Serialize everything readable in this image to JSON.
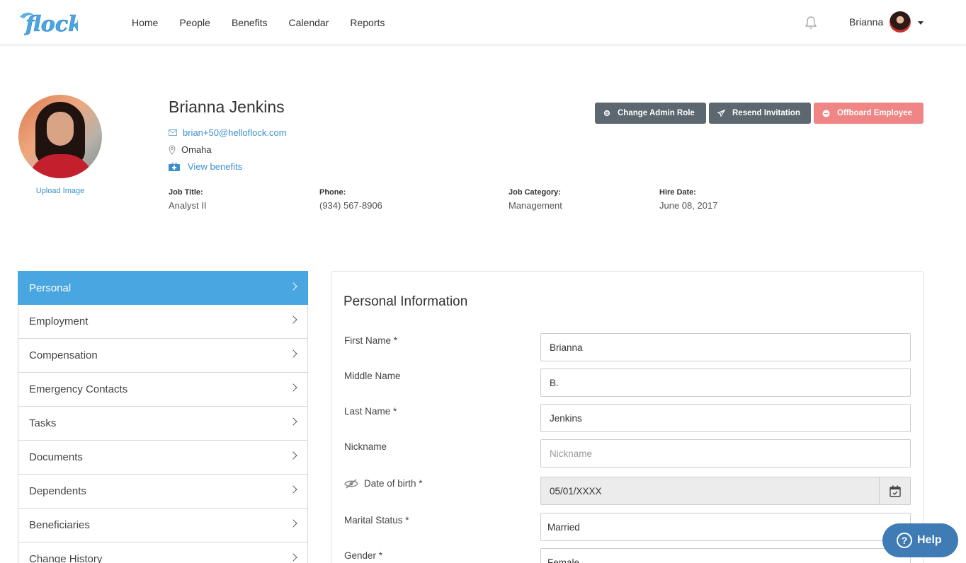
{
  "app": {
    "logo_text": "flock"
  },
  "nav": [
    "Home",
    "People",
    "Benefits",
    "Calendar",
    "Reports"
  ],
  "user": {
    "name": "Brianna"
  },
  "profile": {
    "name": "Brianna Jenkins",
    "email": "brian+50@helloflock.com",
    "location": "Omaha",
    "benefits_link": "View benefits",
    "upload_label": "Upload Image",
    "meta": [
      {
        "label": "Job Title:",
        "value": "Analyst II"
      },
      {
        "label": "Phone:",
        "value": "(934) 567-8906"
      },
      {
        "label": "Job Category:",
        "value": "Management"
      },
      {
        "label": "Hire Date:",
        "value": "June 08, 2017"
      }
    ]
  },
  "actions": {
    "change_admin": "Change Admin Role",
    "resend": "Resend Invitation",
    "offboard": "Offboard Employee"
  },
  "sidebar": {
    "items": [
      "Personal",
      "Employment",
      "Compensation",
      "Emergency Contacts",
      "Tasks",
      "Documents",
      "Dependents",
      "Beneficiaries",
      "Change History"
    ],
    "active": "Personal"
  },
  "panel": {
    "title": "Personal Information",
    "fields": {
      "first_name": {
        "label": "First Name *",
        "value": "Brianna"
      },
      "middle_name": {
        "label": "Middle Name",
        "value": "B."
      },
      "last_name": {
        "label": "Last Name *",
        "value": "Jenkins"
      },
      "nickname": {
        "label": "Nickname",
        "value": "",
        "placeholder": "Nickname"
      },
      "dob": {
        "label": "Date of birth *",
        "value": "05/01/XXXX"
      },
      "marital_status": {
        "label": "Marital Status *",
        "value": "Married"
      },
      "gender": {
        "label": "Gender *",
        "value": "Female"
      }
    }
  },
  "help": {
    "label": "Help"
  },
  "colors": {
    "accent": "#4aa6e0",
    "link": "#3d8fcc",
    "danger": "#ef8585",
    "dark_button": "#5d6770",
    "help": "#3f7bb4"
  }
}
